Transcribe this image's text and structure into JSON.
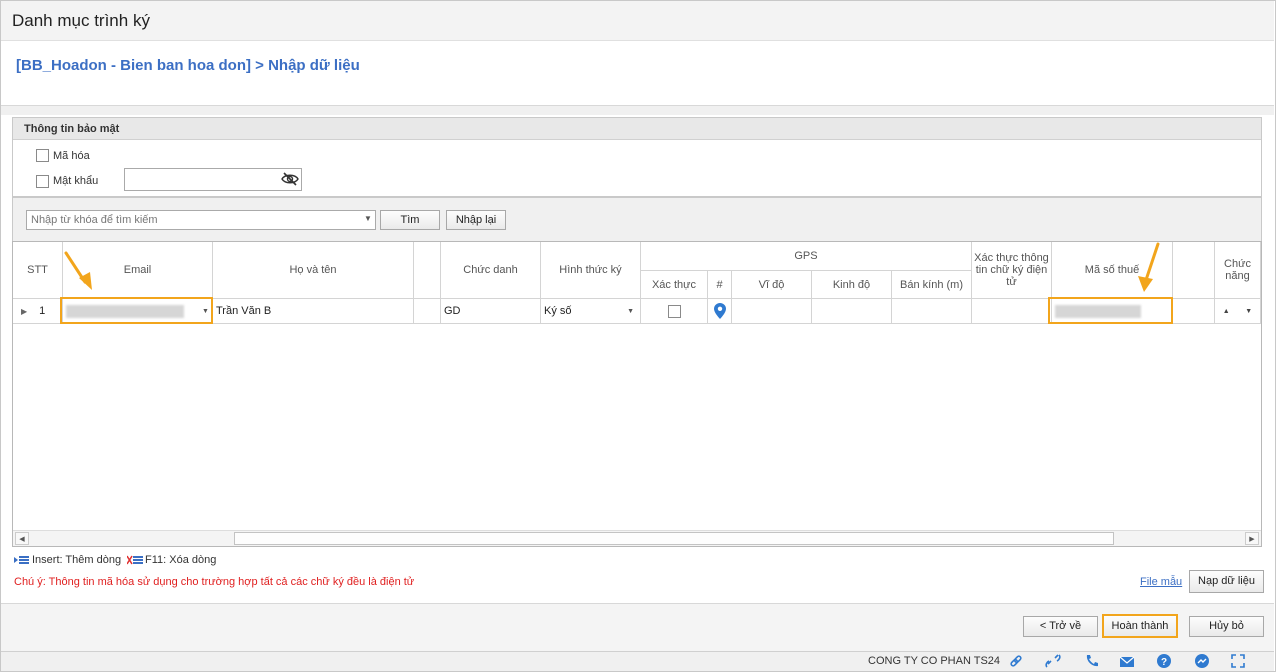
{
  "window": {
    "title": "Danh mục trình ký"
  },
  "breadcrumb": "[BB_Hoadon - Bien ban hoa don] > Nhập dữ liệu",
  "security": {
    "title": "Thông tin bảo mật",
    "encrypt_label": "Mã hóa",
    "password_label": "Mật khẩu",
    "password_value": ""
  },
  "search": {
    "placeholder": "Nhập từ khóa để tìm kiếm",
    "find_label": "Tìm",
    "reset_label": "Nhập lại"
  },
  "grid": {
    "headers": {
      "stt": "STT",
      "email": "Email",
      "name": "Họ và tên",
      "title": "Chức danh",
      "sign_type": "Hình thức ký",
      "gps": "GPS",
      "verify": "Xác thực",
      "hash": "#",
      "lat": "Vĩ độ",
      "lng": "Kinh độ",
      "radius": "Bán kính (m)",
      "esign_verify": "Xác thực thông tin chữ ký điện tử",
      "tax_code": "Mã số thuế",
      "func": "Chức năng"
    },
    "rows": [
      {
        "stt": "1",
        "email": "",
        "name": "Trần Văn B",
        "title": "GD",
        "sign_type": "Ký số",
        "lat": "",
        "lng": "",
        "radius": "",
        "tax_code": ""
      }
    ]
  },
  "tips": {
    "insert": "Insert: Thêm dòng",
    "delete": "F11: Xóa dòng"
  },
  "note": "Chú ý: Thông tin mã hóa sử dụng cho trường hợp tất cả các chữ ký đều là điện tử",
  "sample_link": "File mẫu",
  "import_label": "Nạp dữ liệu",
  "actions": {
    "back": "< Trở về",
    "finish": "Hoàn thành",
    "cancel": "Hủy bỏ"
  },
  "status": {
    "company": "CONG TY CO PHAN TS24"
  },
  "colors": {
    "accent": "#3c6fc4",
    "highlight": "#f2a51c",
    "warning": "#e02020"
  }
}
